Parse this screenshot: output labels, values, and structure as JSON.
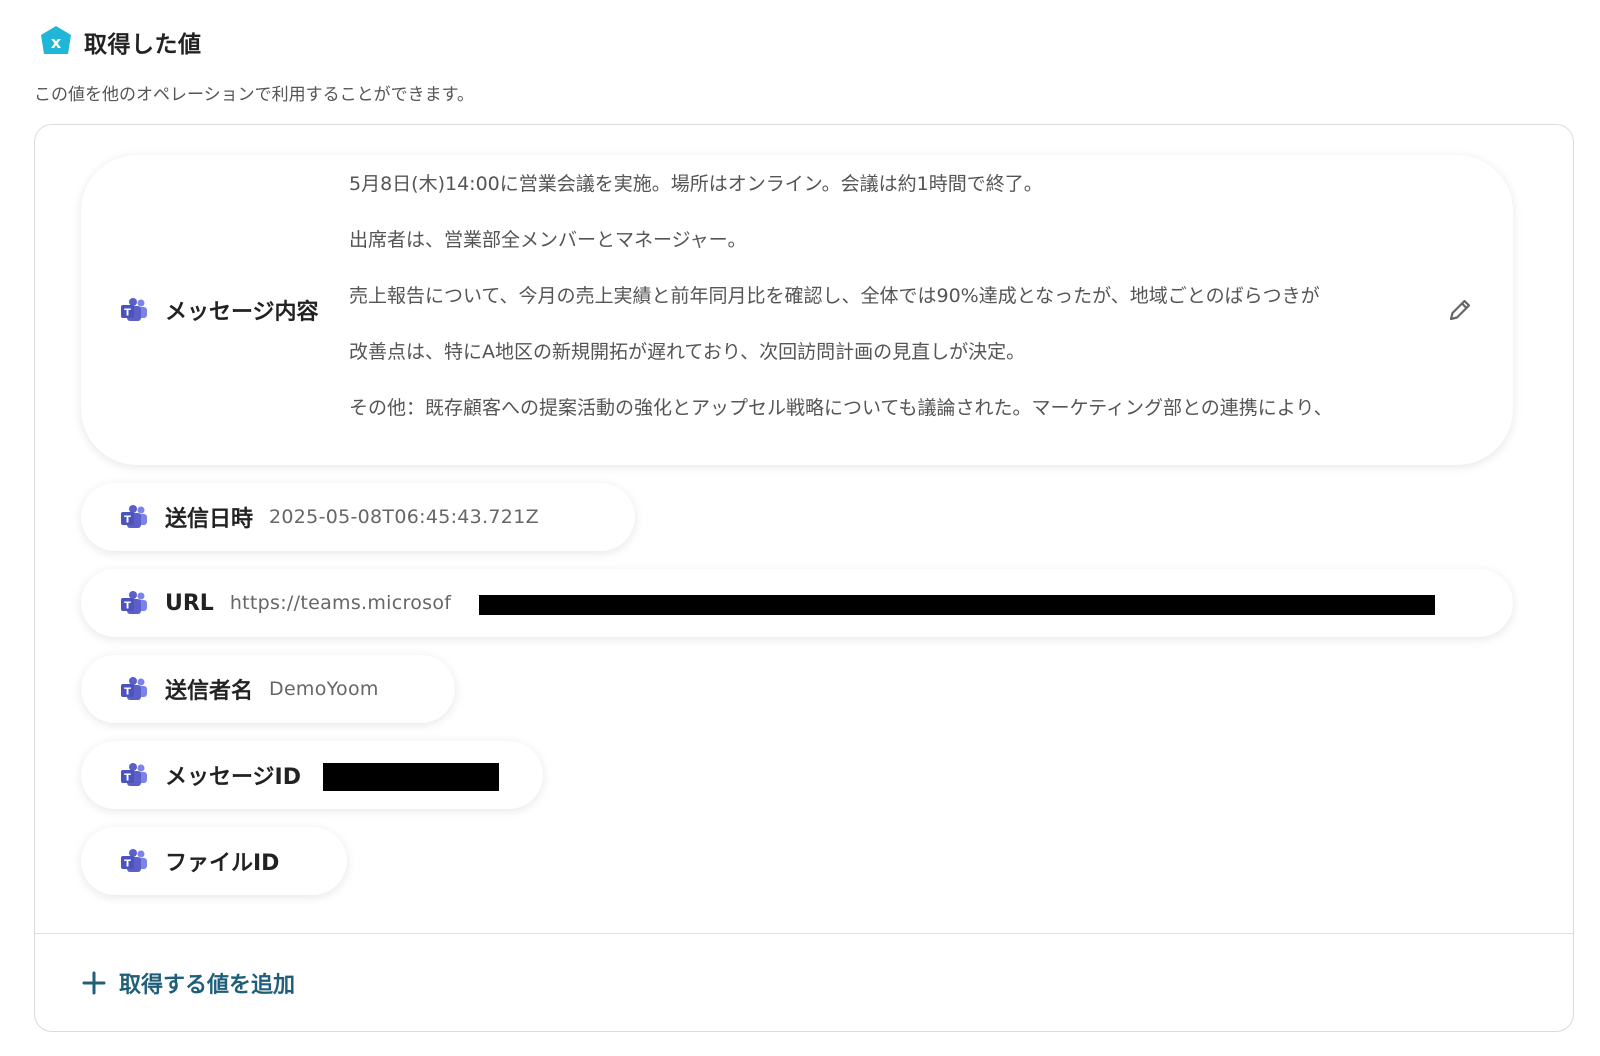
{
  "header": {
    "title": "取得した値",
    "subtitle": "この値を他のオペレーションで利用することができます。"
  },
  "message_field": {
    "label": "メッセージ内容",
    "lines": [
      "5月8日(木)14:00に営業会議を実施。場所はオンライン。会議は約1時間で終了。",
      "出席者は、営業部全メンバーとマネージャー。",
      "売上報告について、今月の売上実績と前年同月比を確認し、全体では90%達成となったが、地域ごとのばらつきが",
      "改善点は、特にA地区の新規開拓が遅れており、次回訪問計画の見直しが決定。",
      "その他：既存顧客への提案活動の強化とアップセル戦略についても議論された。マーケティング部との連携により、"
    ]
  },
  "fields": {
    "sent_at": {
      "label": "送信日時",
      "value": "2025-05-08T06:45:43.721Z"
    },
    "url": {
      "label": "URL",
      "value": "https://teams.microsof"
    },
    "sender": {
      "label": "送信者名",
      "value": "DemoYoom"
    },
    "message_id": {
      "label": "メッセージID"
    },
    "file_id": {
      "label": "ファイルID"
    }
  },
  "add_button": {
    "label": "取得する値を追加"
  },
  "colors": {
    "accent": "#1f5f7a",
    "header_icon": "#1fb6d8",
    "teams": "#5b5fc7"
  },
  "icons": {
    "header": "yoom-x-hex-icon",
    "item": "microsoft-teams-icon",
    "edit": "pencil-icon",
    "add": "plus-icon"
  }
}
